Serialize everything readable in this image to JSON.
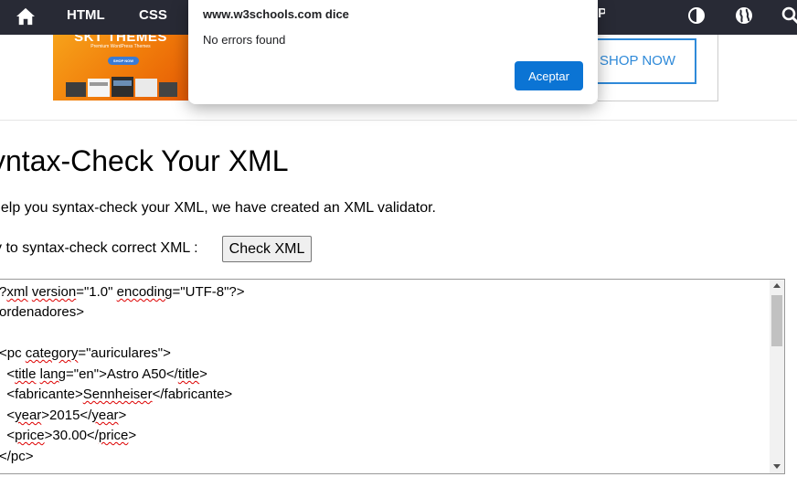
{
  "nav": {
    "items": [
      "HTML",
      "CSS"
    ],
    "icons": [
      "home-icon",
      "contrast-icon",
      "globe-icon",
      "search-icon"
    ],
    "bg_color": "#282a35"
  },
  "ad": {
    "banner_title": "SKT THEMES",
    "banner_subtitle": "Premium WordPress Themes",
    "banner_button": "SHOP NOW",
    "shop_button": "SHOP NOW"
  },
  "dialog": {
    "title": "www.w3schools.com dice",
    "message": "No errors found",
    "ok_label": "Aceptar",
    "ok_color": "#0b74d4"
  },
  "main": {
    "title": "yntax-Check Your XML",
    "intro": " help you syntax-check your XML, we have created an XML validator.",
    "try_text": "y to syntax-check correct XML :",
    "check_button": "Check XML"
  },
  "code": {
    "line1_a": "?",
    "line1_xml": "xml",
    "line1_sp": " ",
    "line1_version": "version",
    "line1_b": "=\"1.0\" ",
    "line1_encoding": "encoding",
    "line1_c": "=\"UTF-8\"?>",
    "line2": "ordenadores>",
    "line4_a": "<pc ",
    "line4_category": "category",
    "line4_b": "=\"auriculares\">",
    "line5_a": "  <",
    "line5_title": "title",
    "line5_sp": " ",
    "line5_lang": "lang",
    "line5_b": "=\"en\">Astro A50</",
    "line5_title2": "title",
    "line5_c": ">",
    "line6_a": "  <fabricante>",
    "line6_senn": "Sennheiser",
    "line6_b": "</fabricante>",
    "line7_a": "  <",
    "line7_year": "year",
    "line7_b": ">2015</",
    "line7_year2": "year",
    "line7_c": ">",
    "line8_a": "  <",
    "line8_price": "price",
    "line8_b": ">30.00</",
    "line8_price2": "price",
    "line8_c": ">",
    "line9": "</pc>"
  }
}
